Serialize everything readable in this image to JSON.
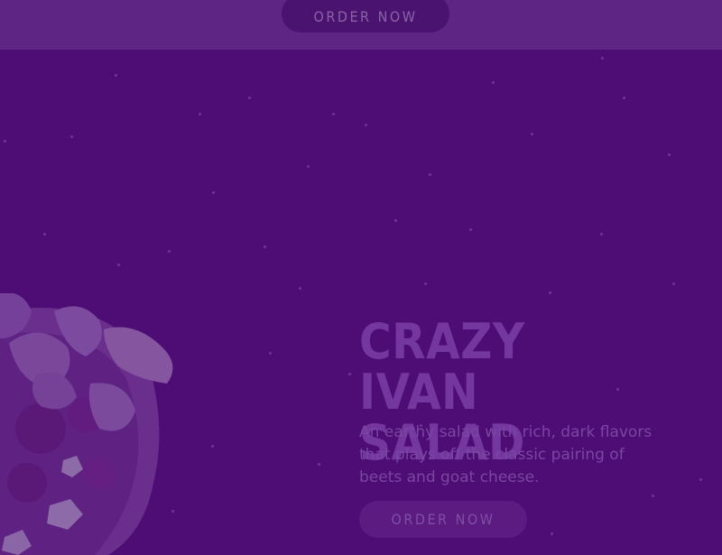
{
  "header": {
    "order_button_label": "ORDER NOW"
  },
  "hero": {
    "title_line1": "CRAZY IVAN",
    "title_line2": "SALAD",
    "description": "An earthy salad with rich, dark flavors that plays off the classic pairing of beets and goat cheese.",
    "order_button_label": "ORDER NOW",
    "image_subject": "salad-bowl"
  },
  "colors": {
    "background": "#4e0d74",
    "header_band": "#5e2585",
    "title": "#7437a0",
    "button": "#5b1b80"
  }
}
